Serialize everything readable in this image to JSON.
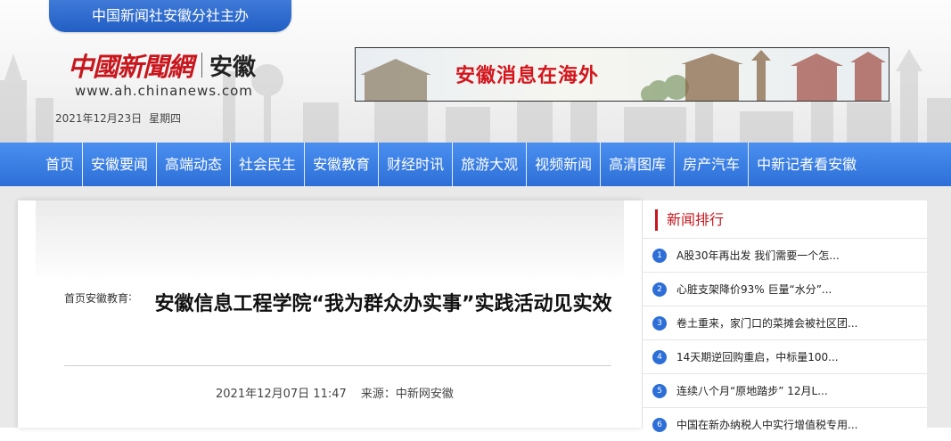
{
  "header": {
    "host": "中国新闻社安徽分社主办",
    "logo_cn": "中國新聞網",
    "logo_region": "安徽",
    "url": "www.ah.chinanews.com",
    "date": "2021年12月23日",
    "weekday": "星期四",
    "banner_text": "安徽消息在海外"
  },
  "nav": {
    "items": [
      "首页",
      "安徽要闻",
      "高端动态",
      "社会民生",
      "安徽教育",
      "财经时讯",
      "旅游大观",
      "视频新闻",
      "高清图库",
      "房产汽车",
      "中新记者看安徽"
    ]
  },
  "article": {
    "breadcrumb_home": "首页",
    "breadcrumb_section": "安徽教育",
    "breadcrumb_colon": ":",
    "title": "安徽信息工程学院“我为群众办实事”实践活动见实效",
    "datetime": "2021年12月07日 11:47",
    "source": "来源：中新网安徽"
  },
  "sidebar": {
    "title": "新闻排行",
    "items": [
      {
        "rank": "1",
        "text": "A股30年再出发 我们需要一个怎..."
      },
      {
        "rank": "2",
        "text": "心脏支架降价93% 巨量“水分”..."
      },
      {
        "rank": "3",
        "text": "卷土重来，家门口的菜摊会被社区团..."
      },
      {
        "rank": "4",
        "text": "14天期逆回购重启，中标量100..."
      },
      {
        "rank": "5",
        "text": "连续八个月“原地踏步” 12月L..."
      },
      {
        "rank": "6",
        "text": "中国在新办纳税人中实行增值税专用..."
      }
    ]
  },
  "colors": {
    "nav_blue": "#2d6fd7",
    "brand_red": "#c8161d"
  }
}
